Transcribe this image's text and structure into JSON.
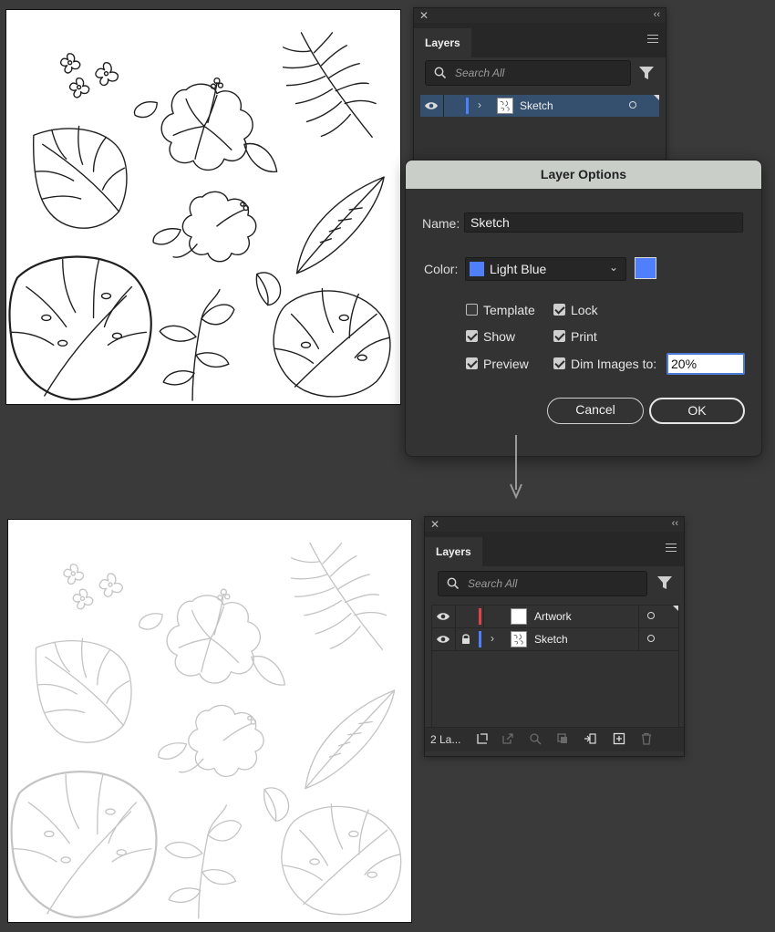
{
  "top_panel": {
    "tab": "Layers",
    "search_placeholder": "Search All",
    "layers": [
      {
        "name": "Sketch",
        "color": "#4f7ffb",
        "selected": true,
        "expanded_chevron": "›"
      }
    ]
  },
  "dialog": {
    "title": "Layer Options",
    "name_label": "Name:",
    "name_value": "Sketch",
    "color_label": "Color:",
    "color_value": "Light Blue",
    "color_hex": "#4f7ffb",
    "checkboxes": {
      "template": {
        "label": "Template",
        "checked": false
      },
      "lock": {
        "label": "Lock",
        "checked": true
      },
      "show": {
        "label": "Show",
        "checked": true
      },
      "print": {
        "label": "Print",
        "checked": true
      },
      "preview": {
        "label": "Preview",
        "checked": true
      },
      "dim": {
        "label": "Dim Images to:",
        "checked": true
      }
    },
    "dim_value": "20%",
    "cancel_label": "Cancel",
    "ok_label": "OK"
  },
  "bottom_panel": {
    "tab": "Layers",
    "search_placeholder": "Search All",
    "layers": [
      {
        "name": "Artwork",
        "color": "#e0434a",
        "locked": false
      },
      {
        "name": "Sketch",
        "color": "#4f7ffb",
        "locked": true
      }
    ],
    "layer_count": "2 La..."
  },
  "icons": [
    "close-icon",
    "collapse-icon",
    "panel-menu-icon",
    "search-icon",
    "filter-icon",
    "eye-icon",
    "lock-icon",
    "chevron-right-icon",
    "target-circle-icon",
    "chevron-down-icon",
    "arrow-down-icon"
  ]
}
